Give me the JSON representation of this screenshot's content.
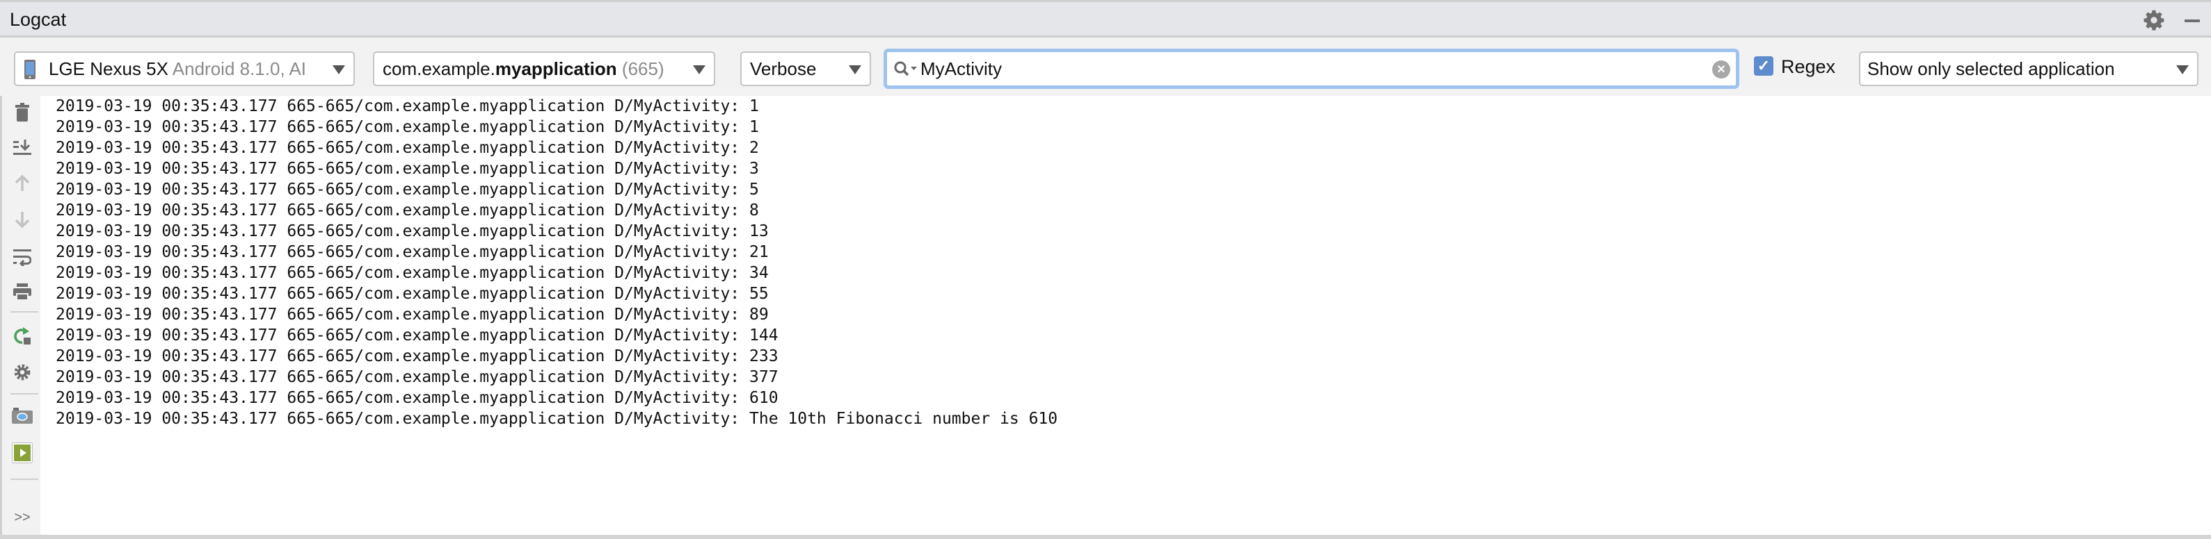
{
  "window": {
    "title": "Logcat"
  },
  "toolbar": {
    "device": {
      "name": "LGE Nexus 5X",
      "detail": "Android 8.1.0, AI"
    },
    "process": {
      "prefix": "com.example.",
      "bold": "myapplication",
      "pid": "(665)"
    },
    "log_level": "Verbose",
    "search": {
      "value": "MyActivity"
    },
    "regex": {
      "label": "Regex",
      "checked": true
    },
    "filter": "Show only selected application"
  },
  "sidebar": {
    "icons": [
      "trash-icon",
      "scroll-to-end-icon",
      "up-arrow-icon",
      "down-arrow-icon",
      "soft-wrap-icon",
      "print-icon",
      "restart-icon",
      "settings-gear-icon",
      "screenshot-camera-icon",
      "screen-record-icon",
      "more-icon"
    ],
    "more_label": ">>"
  },
  "log_lines": [
    "2019-03-19 00:35:43.177 665-665/com.example.myapplication D/MyActivity: 1",
    "2019-03-19 00:35:43.177 665-665/com.example.myapplication D/MyActivity: 1",
    "2019-03-19 00:35:43.177 665-665/com.example.myapplication D/MyActivity: 2",
    "2019-03-19 00:35:43.177 665-665/com.example.myapplication D/MyActivity: 3",
    "2019-03-19 00:35:43.177 665-665/com.example.myapplication D/MyActivity: 5",
    "2019-03-19 00:35:43.177 665-665/com.example.myapplication D/MyActivity: 8",
    "2019-03-19 00:35:43.177 665-665/com.example.myapplication D/MyActivity: 13",
    "2019-03-19 00:35:43.177 665-665/com.example.myapplication D/MyActivity: 21",
    "2019-03-19 00:35:43.177 665-665/com.example.myapplication D/MyActivity: 34",
    "2019-03-19 00:35:43.177 665-665/com.example.myapplication D/MyActivity: 55",
    "2019-03-19 00:35:43.177 665-665/com.example.myapplication D/MyActivity: 89",
    "2019-03-19 00:35:43.177 665-665/com.example.myapplication D/MyActivity: 144",
    "2019-03-19 00:35:43.177 665-665/com.example.myapplication D/MyActivity: 233",
    "2019-03-19 00:35:43.177 665-665/com.example.myapplication D/MyActivity: 377",
    "2019-03-19 00:35:43.177 665-665/com.example.myapplication D/MyActivity: 610",
    "2019-03-19 00:35:43.177 665-665/com.example.myapplication D/MyActivity: The 10th Fibonacci number is 610"
  ],
  "colors": {
    "accent": "#5d8bcd",
    "focus": "#9fc3ee",
    "run_green": "#4ca05a",
    "record_green": "#8aa23a"
  }
}
